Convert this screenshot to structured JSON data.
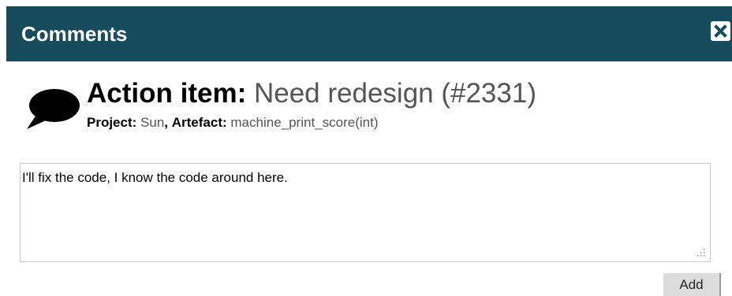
{
  "dialog": {
    "title": "Comments",
    "close_icon": "close-icon"
  },
  "item": {
    "icon": "speech-bubble-icon",
    "label": "Action item:",
    "name": "Need redesign (#2331)",
    "project_label": "Project:",
    "project_value": "Sun",
    "separator": ",",
    "artefact_label": "Artefact:",
    "artefact_value": "machine_print_score(int)"
  },
  "comment": {
    "text": "I'll fix the code, I know the code around here."
  },
  "actions": {
    "add_label": "Add"
  },
  "colors": {
    "titlebar": "#174c5d",
    "secondary_text": "#555555"
  }
}
